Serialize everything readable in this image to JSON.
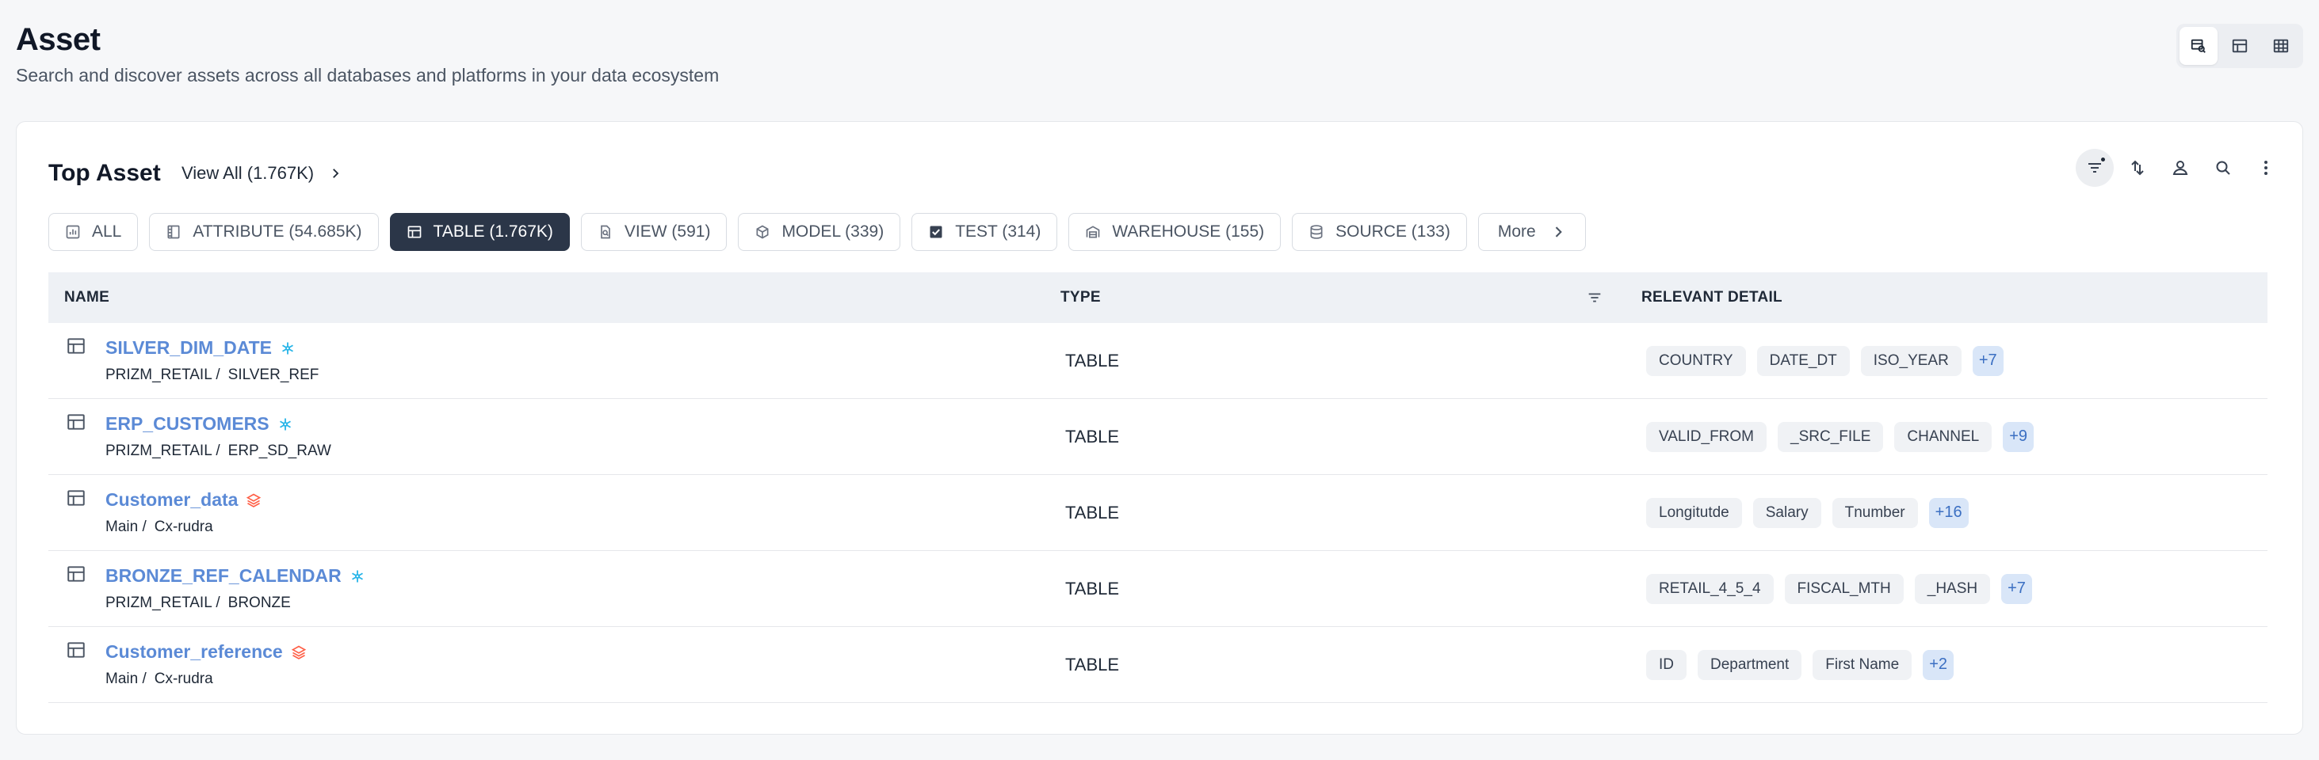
{
  "header": {
    "title": "Asset",
    "subtitle": "Search and discover assets across all databases and platforms in your data ecosystem"
  },
  "view_switch": [
    {
      "icon": "search-table-icon",
      "active": true
    },
    {
      "icon": "table-layout-icon",
      "active": false
    },
    {
      "icon": "grid-icon",
      "active": false
    }
  ],
  "card": {
    "title": "Top Asset",
    "view_all_label": "View All (1.767K)"
  },
  "toolbar": [
    "filter-icon",
    "sort-icon",
    "user-icon",
    "search-icon",
    "more-vertical-icon"
  ],
  "chips": [
    {
      "label": "ALL",
      "icon": "chart-icon",
      "active": false
    },
    {
      "label": "ATTRIBUTE (54.685K)",
      "icon": "attribute-icon",
      "active": false
    },
    {
      "label": "TABLE (1.767K)",
      "icon": "table-icon",
      "active": true
    },
    {
      "label": "VIEW (591)",
      "icon": "view-icon",
      "active": false
    },
    {
      "label": "MODEL (339)",
      "icon": "cube-icon",
      "active": false
    },
    {
      "label": "TEST (314)",
      "icon": "checkbox-icon",
      "active": false
    },
    {
      "label": "WAREHOUSE (155)",
      "icon": "warehouse-icon",
      "active": false
    },
    {
      "label": "SOURCE (133)",
      "icon": "database-icon",
      "active": false
    }
  ],
  "more_label": "More",
  "table": {
    "columns": {
      "name": "NAME",
      "type": "TYPE",
      "detail": "RELEVANT DETAIL"
    },
    "rows": [
      {
        "name": "SILVER_DIM_DATE",
        "platform": "snowflake",
        "path1": "PRIZM_RETAIL /",
        "path2": "SILVER_REF",
        "type": "TABLE",
        "tags": [
          "COUNTRY",
          "DATE_DT",
          "ISO_YEAR"
        ],
        "more": "+7"
      },
      {
        "name": "ERP_CUSTOMERS",
        "platform": "snowflake",
        "path1": "PRIZM_RETAIL /",
        "path2": "ERP_SD_RAW",
        "type": "TABLE",
        "tags": [
          "VALID_FROM",
          "_SRC_FILE",
          "CHANNEL"
        ],
        "more": "+9"
      },
      {
        "name": "Customer_data",
        "platform": "databricks",
        "path1": "Main /",
        "path2": "Cx-rudra",
        "type": "TABLE",
        "tags": [
          "Longitutde",
          "Salary",
          "Tnumber"
        ],
        "more": "+16"
      },
      {
        "name": "BRONZE_REF_CALENDAR",
        "platform": "snowflake",
        "path1": "PRIZM_RETAIL /",
        "path2": "BRONZE",
        "type": "TABLE",
        "tags": [
          "RETAIL_4_5_4",
          "FISCAL_MTH",
          "_HASH"
        ],
        "more": "+7"
      },
      {
        "name": "Customer_reference",
        "platform": "databricks",
        "path1": "Main /",
        "path2": "Cx-rudra",
        "type": "TABLE",
        "tags": [
          "ID",
          "Department",
          "First Name"
        ],
        "more": "+2"
      }
    ]
  },
  "colors": {
    "accent_link": "#5b8ad6",
    "active_chip": "#2b3648",
    "snowflake": "#29b5e8",
    "databricks": "#ff5f46"
  }
}
